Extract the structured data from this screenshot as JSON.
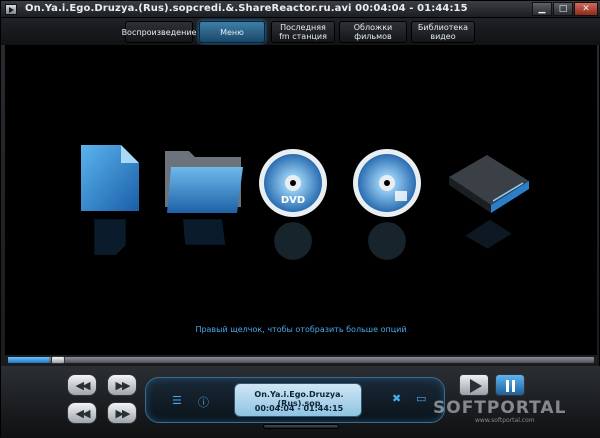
{
  "window": {
    "title": "On.Ya.i.Ego.Druzya.(Rus).sopcredi.&.ShareReactor.ru.avi   00:04:04 - 01:44:15"
  },
  "tabs": [
    {
      "label": "Воспроизведение"
    },
    {
      "label": "Меню"
    },
    {
      "label": "Последняя fm станция"
    },
    {
      "label": "Обложки фильмов"
    },
    {
      "label": "Библиотека видео"
    }
  ],
  "main": {
    "hint": "Правый щелчок, чтобы отобразить больше опций",
    "icons": [
      "file-icon",
      "folder-icon",
      "dvd-icon",
      "cd-icon",
      "device-icon"
    ]
  },
  "seek": {
    "progress": 0.04
  },
  "lcd": {
    "line1": "On.Ya.i.Ego.Druzya.(Rus).sop",
    "line2": "00:04:04 - 01:44:15"
  },
  "watermark": {
    "text": "SOFTPORTAL",
    "sub": "www.softportal.com"
  },
  "colors": {
    "accent": "#2d8ad0",
    "hint": "#49a7e8"
  }
}
